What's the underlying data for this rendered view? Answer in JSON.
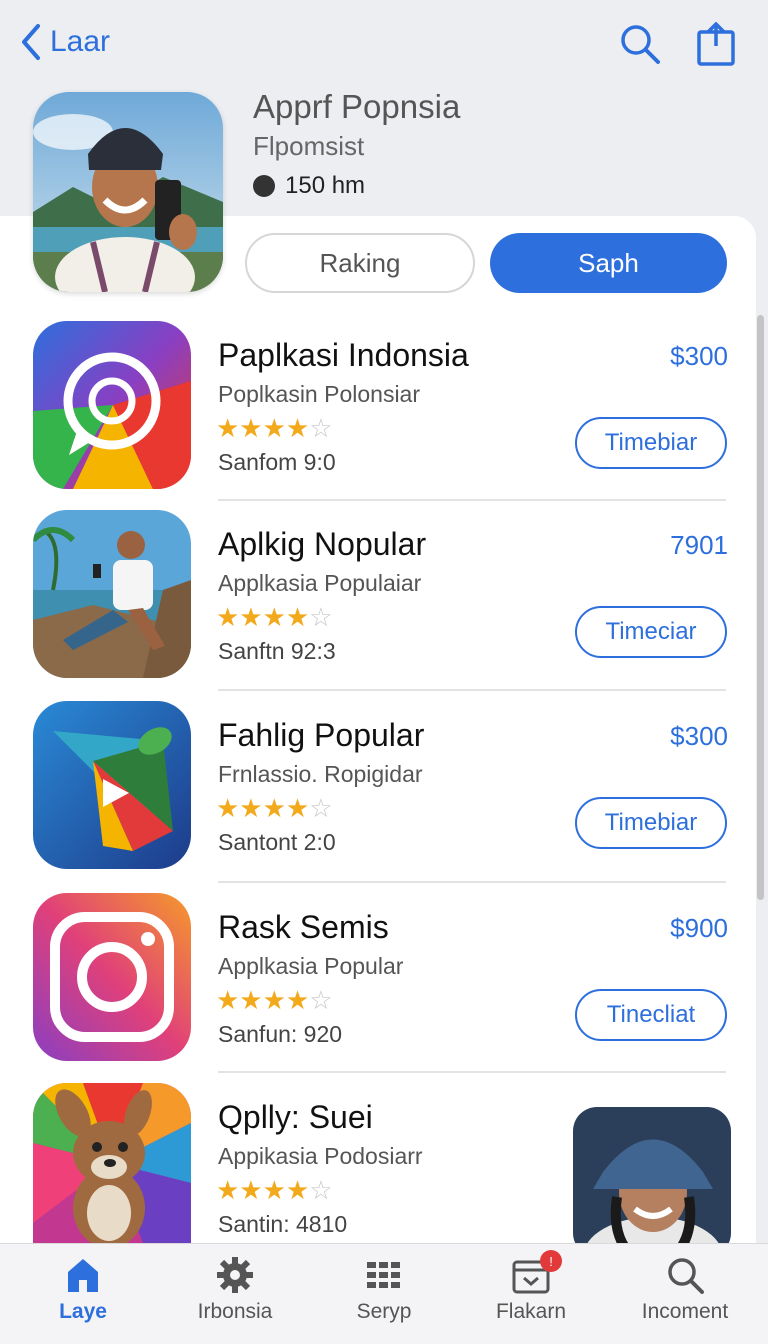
{
  "nav": {
    "back_label": "Laar"
  },
  "hero": {
    "title": "Apprf Popnsia",
    "subtitle": "Flpomsist",
    "meta": "150 hm"
  },
  "segments": [
    "Raking",
    "Saph"
  ],
  "apps": [
    {
      "name": "Paplkasi Indonsia",
      "desc": "Poplkasin Polonsiar",
      "rating": 4,
      "size": "Sanfom 9:0",
      "price": "$300",
      "action": "Timebiar"
    },
    {
      "name": "Aplkig Nopular",
      "desc": "Applkasia Populaiar",
      "rating": 3.5,
      "size": "Sanftn 92:3",
      "price": "7901",
      "action": "Timeciar"
    },
    {
      "name": "Fahlig Popular",
      "desc": "Frnlassio. Ropigidar",
      "rating": 3.5,
      "size": "Santont 2:0",
      "price": "$300",
      "action": "Timebiar"
    },
    {
      "name": "Rask Semis",
      "desc": "Applkasia Popular",
      "rating": 3.5,
      "size": "Sanfun: 920",
      "price": "$900",
      "action": "Tinecliat"
    },
    {
      "name": "Qplly: Suei",
      "desc": "Appikasia Podosiarr",
      "rating": 3.5,
      "size": "Santin: 4810"
    }
  ],
  "tabs": [
    {
      "label": "Laye",
      "icon": "home-icon"
    },
    {
      "label": "Irbonsia",
      "icon": "gear-icon"
    },
    {
      "label": "Seryp",
      "icon": "grid-icon"
    },
    {
      "label": "Flakarn",
      "icon": "calendar-icon",
      "badge": "!"
    },
    {
      "label": "Incoment",
      "icon": "search-icon"
    }
  ],
  "colors": {
    "accent": "#2d6fdc",
    "star": "#f2a91c",
    "badge": "#e23a3a"
  }
}
